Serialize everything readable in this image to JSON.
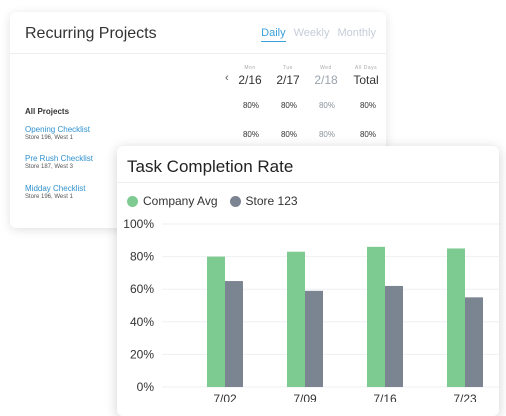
{
  "recurring": {
    "title": "Recurring Projects",
    "tabs": [
      {
        "label": "Daily",
        "active": true
      },
      {
        "label": "Weekly",
        "active": false
      },
      {
        "label": "Monthly",
        "active": false
      }
    ],
    "nav_prev": "‹",
    "columns": [
      {
        "dow": "Mon",
        "date": "2/16"
      },
      {
        "dow": "Tue",
        "date": "2/17"
      },
      {
        "dow": "Wed",
        "date": "2/18"
      },
      {
        "dow": "All Days",
        "date": "Total"
      }
    ],
    "rows": [
      {
        "name": "All Projects",
        "sub": "",
        "values": [
          "80%",
          "80%",
          "80%",
          "80%"
        ]
      },
      {
        "name": "Opening Checklist",
        "sub": "Store 196, West 1",
        "values": [
          "80%",
          "80%",
          "80%",
          "80%"
        ]
      },
      {
        "name": "Pre Rush Checklist",
        "sub": "Store 187, West 3",
        "values": [
          "",
          "",
          "",
          ""
        ]
      },
      {
        "name": "Midday Checklist",
        "sub": "Store 196, West 1",
        "values": [
          "",
          "",
          "",
          ""
        ]
      }
    ]
  },
  "task_completion": {
    "title": "Task Completion Rate",
    "colors": {
      "company": "#7ecb92",
      "store": "#7b8491"
    }
  },
  "chart_data": {
    "type": "bar",
    "title": "Task Completion Rate",
    "categories": [
      "7/02",
      "7/09",
      "7/16",
      "7/23"
    ],
    "series": [
      {
        "name": "Company Avg",
        "values": [
          80,
          83,
          86,
          85
        ]
      },
      {
        "name": "Store 123",
        "values": [
          65,
          59,
          62,
          55
        ]
      }
    ],
    "ylim": [
      0,
      100
    ],
    "yticks": [
      "0%",
      "20%",
      "40%",
      "60%",
      "80%",
      "100%"
    ],
    "grid": true,
    "legend": "top-left"
  }
}
